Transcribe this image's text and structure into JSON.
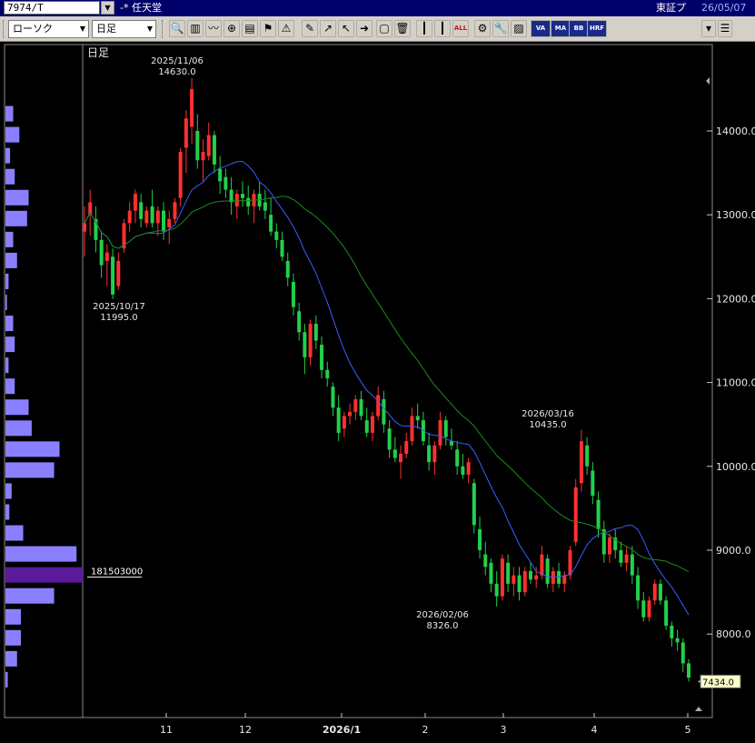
{
  "title_bar": {
    "symbol": "7974/T",
    "mode_marker": "-*",
    "company_name": "任天堂",
    "market": "東証プ",
    "date": "26/05/07"
  },
  "toolbar": {
    "chart_type": "ローソク",
    "period": "日足",
    "icons": [
      "search-icon",
      "split-view-icon",
      "line-chart-icon",
      "zoom-icon",
      "bar-toggle-icon",
      "alert-flag-icon",
      "warning-icon",
      "pencil-icon",
      "trendline-icon",
      "cursor-icon",
      "arrow-icon",
      "copy-icon",
      "delete-icon",
      "candle-icon",
      "candle-outline-icon",
      "all-label-icon",
      "settings-icon",
      "wrench-icon",
      "color-icon",
      "volume-profile-icon",
      "ma-icon",
      "bb-icon",
      "hrf-icon",
      "scroll-down-icon",
      "menu-icon"
    ],
    "icon_labels": {
      "all": "ALL",
      "ma": "MA",
      "bb": "BB",
      "hrf": "HRF",
      "vp": "VA RP"
    }
  },
  "chart_data": {
    "type": "candlestick",
    "period_label": "日足",
    "y_axis": {
      "min": 7200,
      "max": 14800,
      "ticks": [
        "14000.0",
        "13000.0",
        "12000.0",
        "11000.0",
        "10000.0",
        "9000.0",
        "8000.0"
      ]
    },
    "x_axis": {
      "ticks": [
        "11",
        "12",
        "2026/1",
        "2",
        "3",
        "4",
        "5"
      ]
    },
    "annotations": [
      {
        "date": "2025/11/06",
        "value": "14630.0",
        "kind": "high"
      },
      {
        "date": "2025/10/17",
        "value": "11995.0",
        "kind": "low"
      },
      {
        "date": "2026/03/16",
        "value": "10435.0",
        "kind": "high"
      },
      {
        "date": "2026/02/06",
        "value": "8326.0",
        "kind": "low"
      }
    ],
    "last_price_label": "7434.0",
    "volume_profile_peak_label": "181503000",
    "volume_profile": [
      {
        "price": 14200,
        "vol": 0.1
      },
      {
        "price": 13950,
        "vol": 0.18
      },
      {
        "price": 13700,
        "vol": 0.06
      },
      {
        "price": 13450,
        "vol": 0.12
      },
      {
        "price": 13200,
        "vol": 0.3
      },
      {
        "price": 12950,
        "vol": 0.28
      },
      {
        "price": 12700,
        "vol": 0.1
      },
      {
        "price": 12450,
        "vol": 0.15
      },
      {
        "price": 12200,
        "vol": 0.04
      },
      {
        "price": 11950,
        "vol": 0.02
      },
      {
        "price": 11700,
        "vol": 0.1
      },
      {
        "price": 11450,
        "vol": 0.12
      },
      {
        "price": 11200,
        "vol": 0.04
      },
      {
        "price": 10950,
        "vol": 0.12
      },
      {
        "price": 10700,
        "vol": 0.3
      },
      {
        "price": 10450,
        "vol": 0.34
      },
      {
        "price": 10200,
        "vol": 0.7
      },
      {
        "price": 9950,
        "vol": 0.63
      },
      {
        "price": 9700,
        "vol": 0.08
      },
      {
        "price": 9450,
        "vol": 0.05
      },
      {
        "price": 9200,
        "vol": 0.23
      },
      {
        "price": 8950,
        "vol": 0.92
      },
      {
        "price": 8700,
        "vol": 1.0,
        "peak": true
      },
      {
        "price": 8450,
        "vol": 0.63
      },
      {
        "price": 8200,
        "vol": 0.2
      },
      {
        "price": 7950,
        "vol": 0.2
      },
      {
        "price": 7700,
        "vol": 0.15
      },
      {
        "price": 7450,
        "vol": 0.03
      }
    ],
    "candles": [
      {
        "o": 12800,
        "h": 13100,
        "l": 12500,
        "c": 12900
      },
      {
        "o": 13000,
        "h": 13300,
        "l": 12750,
        "c": 13150
      },
      {
        "o": 12950,
        "h": 13100,
        "l": 12550,
        "c": 12700
      },
      {
        "o": 12700,
        "h": 12800,
        "l": 12250,
        "c": 12400
      },
      {
        "o": 12450,
        "h": 12650,
        "l": 12150,
        "c": 12550
      },
      {
        "o": 12500,
        "h": 12600,
        "l": 11995,
        "c": 12050
      },
      {
        "o": 12150,
        "h": 12550,
        "l": 12100,
        "c": 12450
      },
      {
        "o": 12600,
        "h": 12950,
        "l": 12550,
        "c": 12900
      },
      {
        "o": 12900,
        "h": 13150,
        "l": 12800,
        "c": 13050
      },
      {
        "o": 13050,
        "h": 13300,
        "l": 12900,
        "c": 13250
      },
      {
        "o": 13150,
        "h": 13250,
        "l": 12850,
        "c": 12950
      },
      {
        "o": 12900,
        "h": 13100,
        "l": 12850,
        "c": 13050
      },
      {
        "o": 13100,
        "h": 13300,
        "l": 12850,
        "c": 12900
      },
      {
        "o": 12900,
        "h": 13100,
        "l": 12750,
        "c": 13050
      },
      {
        "o": 13050,
        "h": 13150,
        "l": 12700,
        "c": 12800
      },
      {
        "o": 12850,
        "h": 13050,
        "l": 12650,
        "c": 12950
      },
      {
        "o": 12950,
        "h": 13200,
        "l": 12900,
        "c": 13150
      },
      {
        "o": 13200,
        "h": 13800,
        "l": 13100,
        "c": 13750
      },
      {
        "o": 13800,
        "h": 14250,
        "l": 13500,
        "c": 14150
      },
      {
        "o": 14050,
        "h": 14630,
        "l": 13850,
        "c": 14500
      },
      {
        "o": 14000,
        "h": 14200,
        "l": 13550,
        "c": 13650
      },
      {
        "o": 13650,
        "h": 13900,
        "l": 13400,
        "c": 13750
      },
      {
        "o": 13700,
        "h": 14100,
        "l": 13650,
        "c": 13950
      },
      {
        "o": 13950,
        "h": 14000,
        "l": 13500,
        "c": 13600
      },
      {
        "o": 13550,
        "h": 13700,
        "l": 13250,
        "c": 13400
      },
      {
        "o": 13450,
        "h": 13550,
        "l": 13200,
        "c": 13300
      },
      {
        "o": 13300,
        "h": 13450,
        "l": 13000,
        "c": 13150
      },
      {
        "o": 13100,
        "h": 13300,
        "l": 12950,
        "c": 13250
      },
      {
        "o": 13250,
        "h": 13400,
        "l": 13100,
        "c": 13200
      },
      {
        "o": 13200,
        "h": 13350,
        "l": 13000,
        "c": 13100
      },
      {
        "o": 13100,
        "h": 13300,
        "l": 12900,
        "c": 13250
      },
      {
        "o": 13250,
        "h": 13400,
        "l": 13050,
        "c": 13100
      },
      {
        "o": 13150,
        "h": 13300,
        "l": 12950,
        "c": 13050
      },
      {
        "o": 13000,
        "h": 13200,
        "l": 12750,
        "c": 12800
      },
      {
        "o": 12800,
        "h": 12900,
        "l": 12600,
        "c": 12700
      },
      {
        "o": 12700,
        "h": 12800,
        "l": 12450,
        "c": 12500
      },
      {
        "o": 12450,
        "h": 12550,
        "l": 12150,
        "c": 12250
      },
      {
        "o": 12200,
        "h": 12300,
        "l": 11800,
        "c": 11900
      },
      {
        "o": 11850,
        "h": 11950,
        "l": 11500,
        "c": 11600
      },
      {
        "o": 11600,
        "h": 11700,
        "l": 11100,
        "c": 11300
      },
      {
        "o": 11300,
        "h": 11750,
        "l": 11200,
        "c": 11700
      },
      {
        "o": 11700,
        "h": 11800,
        "l": 11400,
        "c": 11500
      },
      {
        "o": 11450,
        "h": 11550,
        "l": 11050,
        "c": 11150
      },
      {
        "o": 11150,
        "h": 11250,
        "l": 10950,
        "c": 11050
      },
      {
        "o": 10950,
        "h": 11000,
        "l": 10600,
        "c": 10700
      },
      {
        "o": 10700,
        "h": 10850,
        "l": 10300,
        "c": 10400
      },
      {
        "o": 10450,
        "h": 10650,
        "l": 10350,
        "c": 10600
      },
      {
        "o": 10600,
        "h": 10750,
        "l": 10500,
        "c": 10650
      },
      {
        "o": 10650,
        "h": 10850,
        "l": 10550,
        "c": 10800
      },
      {
        "o": 10800,
        "h": 10900,
        "l": 10550,
        "c": 10600
      },
      {
        "o": 10550,
        "h": 10700,
        "l": 10350,
        "c": 10400
      },
      {
        "o": 10400,
        "h": 10650,
        "l": 10300,
        "c": 10600
      },
      {
        "o": 10600,
        "h": 10950,
        "l": 10550,
        "c": 10850
      },
      {
        "o": 10800,
        "h": 10900,
        "l": 10400,
        "c": 10500
      },
      {
        "o": 10450,
        "h": 10550,
        "l": 10100,
        "c": 10200
      },
      {
        "o": 10200,
        "h": 10350,
        "l": 10050,
        "c": 10100
      },
      {
        "o": 10050,
        "h": 10250,
        "l": 9850,
        "c": 10150
      },
      {
        "o": 10150,
        "h": 10400,
        "l": 10100,
        "c": 10300
      },
      {
        "o": 10300,
        "h": 10700,
        "l": 10250,
        "c": 10600
      },
      {
        "o": 10600,
        "h": 10750,
        "l": 10450,
        "c": 10550
      },
      {
        "o": 10550,
        "h": 10650,
        "l": 10250,
        "c": 10300
      },
      {
        "o": 10250,
        "h": 10400,
        "l": 9950,
        "c": 10050
      },
      {
        "o": 10050,
        "h": 10300,
        "l": 9900,
        "c": 10250
      },
      {
        "o": 10250,
        "h": 10650,
        "l": 10200,
        "c": 10550
      },
      {
        "o": 10550,
        "h": 10600,
        "l": 10250,
        "c": 10350
      },
      {
        "o": 10300,
        "h": 10450,
        "l": 10200,
        "c": 10250
      },
      {
        "o": 10200,
        "h": 10300,
        "l": 9900,
        "c": 10000
      },
      {
        "o": 10000,
        "h": 10150,
        "l": 9850,
        "c": 9900
      },
      {
        "o": 9900,
        "h": 10100,
        "l": 9800,
        "c": 10050
      },
      {
        "o": 9800,
        "h": 9850,
        "l": 9200,
        "c": 9300
      },
      {
        "o": 9250,
        "h": 9400,
        "l": 8900,
        "c": 9000
      },
      {
        "o": 8950,
        "h": 9100,
        "l": 8700,
        "c": 8800
      },
      {
        "o": 8850,
        "h": 8900,
        "l": 8500,
        "c": 8600
      },
      {
        "o": 8600,
        "h": 8750,
        "l": 8326,
        "c": 8450
      },
      {
        "o": 8450,
        "h": 8950,
        "l": 8400,
        "c": 8900
      },
      {
        "o": 8850,
        "h": 8950,
        "l": 8500,
        "c": 8600
      },
      {
        "o": 8600,
        "h": 8800,
        "l": 8450,
        "c": 8700
      },
      {
        "o": 8700,
        "h": 8800,
        "l": 8400,
        "c": 8500
      },
      {
        "o": 8500,
        "h": 8800,
        "l": 8450,
        "c": 8750
      },
      {
        "o": 8750,
        "h": 8850,
        "l": 8600,
        "c": 8650
      },
      {
        "o": 8650,
        "h": 8800,
        "l": 8550,
        "c": 8700
      },
      {
        "o": 8700,
        "h": 9050,
        "l": 8650,
        "c": 8950
      },
      {
        "o": 8900,
        "h": 8950,
        "l": 8550,
        "c": 8600
      },
      {
        "o": 8600,
        "h": 8800,
        "l": 8500,
        "c": 8750
      },
      {
        "o": 8750,
        "h": 8850,
        "l": 8550,
        "c": 8600
      },
      {
        "o": 8600,
        "h": 8750,
        "l": 8500,
        "c": 8700
      },
      {
        "o": 8700,
        "h": 9050,
        "l": 8650,
        "c": 9000
      },
      {
        "o": 9100,
        "h": 9850,
        "l": 9050,
        "c": 9750
      },
      {
        "o": 9800,
        "h": 10435,
        "l": 9700,
        "c": 10300
      },
      {
        "o": 10250,
        "h": 10350,
        "l": 9900,
        "c": 10000
      },
      {
        "o": 9950,
        "h": 10050,
        "l": 9550,
        "c": 9650
      },
      {
        "o": 9600,
        "h": 9700,
        "l": 9150,
        "c": 9250
      },
      {
        "o": 9250,
        "h": 9350,
        "l": 8850,
        "c": 8950
      },
      {
        "o": 8950,
        "h": 9200,
        "l": 8850,
        "c": 9150
      },
      {
        "o": 9150,
        "h": 9250,
        "l": 8900,
        "c": 9000
      },
      {
        "o": 9000,
        "h": 9100,
        "l": 8800,
        "c": 8850
      },
      {
        "o": 8850,
        "h": 9050,
        "l": 8750,
        "c": 8950
      },
      {
        "o": 8950,
        "h": 9050,
        "l": 8600,
        "c": 8700
      },
      {
        "o": 8700,
        "h": 8800,
        "l": 8300,
        "c": 8400
      },
      {
        "o": 8400,
        "h": 8500,
        "l": 8150,
        "c": 8200
      },
      {
        "o": 8200,
        "h": 8450,
        "l": 8150,
        "c": 8400
      },
      {
        "o": 8400,
        "h": 8650,
        "l": 8350,
        "c": 8600
      },
      {
        "o": 8600,
        "h": 8650,
        "l": 8350,
        "c": 8400
      },
      {
        "o": 8400,
        "h": 8450,
        "l": 8050,
        "c": 8100
      },
      {
        "o": 8100,
        "h": 8150,
        "l": 7850,
        "c": 7950
      },
      {
        "o": 7950,
        "h": 8050,
        "l": 7800,
        "c": 7900
      },
      {
        "o": 7900,
        "h": 7950,
        "l": 7550,
        "c": 7650
      },
      {
        "o": 7650,
        "h": 7700,
        "l": 7434,
        "c": 7480
      }
    ],
    "ma_short_color": "#3c5cff",
    "ma_long_color": "#1e8a1e",
    "up_color": "#ff3030",
    "down_color": "#22d04a"
  }
}
